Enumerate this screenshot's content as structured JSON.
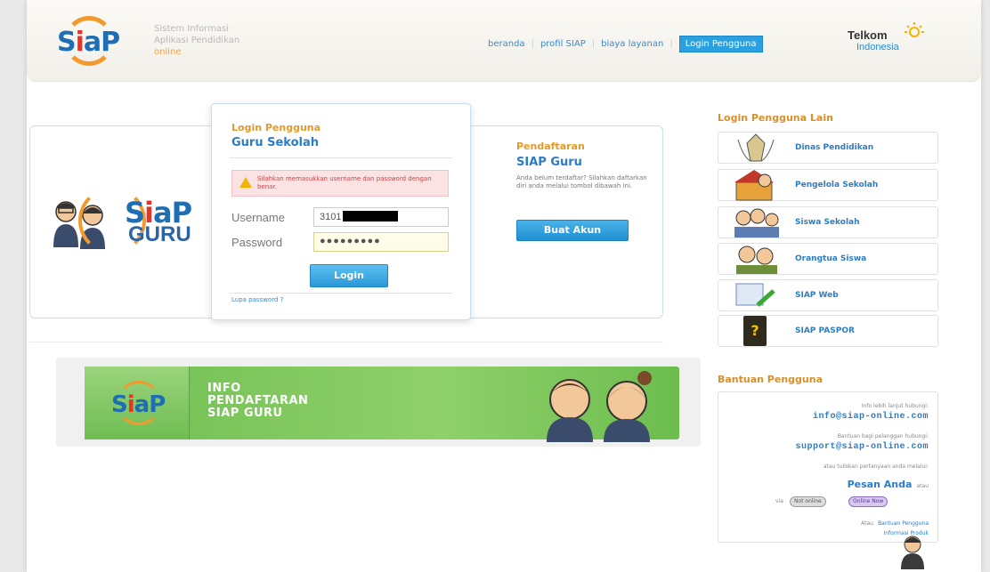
{
  "header": {
    "tagline": [
      "Sistem Informasi",
      "Aplikasi Pendidikan"
    ],
    "tagline_online": "online",
    "nav": [
      {
        "label": "beranda"
      },
      {
        "label": "profil SIAP"
      },
      {
        "label": "biaya layanan"
      },
      {
        "label": "Login Pengguna",
        "active": true
      }
    ],
    "partner": {
      "name": "Telkom",
      "sub": "Indonesia"
    }
  },
  "brand": {
    "s": "S",
    "i": "i",
    "ap": "aP",
    "guru": "GURU"
  },
  "login": {
    "kicker": "Login Pengguna",
    "title": "Guru Sekolah",
    "alert": "Silahkan memasukkan username dan password dengan benar.",
    "username_label": "Username",
    "username_value": "3101",
    "password_label": "Password",
    "password_value": "●●●●●●●●●",
    "button": "Login",
    "forgot": "Lupa password ?"
  },
  "registration": {
    "kicker": "Pendaftaran",
    "title": "SIAP Guru",
    "description": "Anda belum terdaftar? Silahkan daftarkan diri anda melalui tombol dibawah ini.",
    "button": "Buat Akun"
  },
  "banner": {
    "lines": [
      "INFO",
      "PENDAFTARAN",
      "SIAP GURU"
    ]
  },
  "sidebar": {
    "title": "Login Pengguna Lain",
    "items": [
      {
        "label": "Dinas Pendidikan",
        "icon": "education-office-emblem-icon"
      },
      {
        "label": "Pengelola Sekolah",
        "icon": "school-manager-icon"
      },
      {
        "label": "Siswa Sekolah",
        "icon": "students-icon"
      },
      {
        "label": "Orangtua Siswa",
        "icon": "parents-icon"
      },
      {
        "label": "SIAP Web",
        "icon": "web-icon"
      },
      {
        "label": "SIAP PASPOR",
        "icon": "passport-icon"
      }
    ],
    "help_title": "Bantuan Pengguna",
    "help": {
      "info_text": "Info lebih lanjut hubungi:",
      "info_mail": "info@siap-online.com",
      "support_text": "Bantuan bagi pelanggan hubungi:",
      "support_mail": "support@siap-online.com",
      "message_text": "atau tuliskan pertanyaan anda melalui:",
      "message_link": "Pesan Anda",
      "message_suffix": "atau",
      "ym_prefix": "via",
      "ym_offline": "Not online",
      "ym_online": "Online Now",
      "or_text": "Atau",
      "link_help": "Bantuan Pengguna",
      "link_info": "Informasi Produk"
    }
  },
  "colors": {
    "accent_blue": "#2b7dc8",
    "accent_orange": "#e39a2a",
    "banner_green": "#7cc55c",
    "button_blue": "#2a98d8"
  }
}
